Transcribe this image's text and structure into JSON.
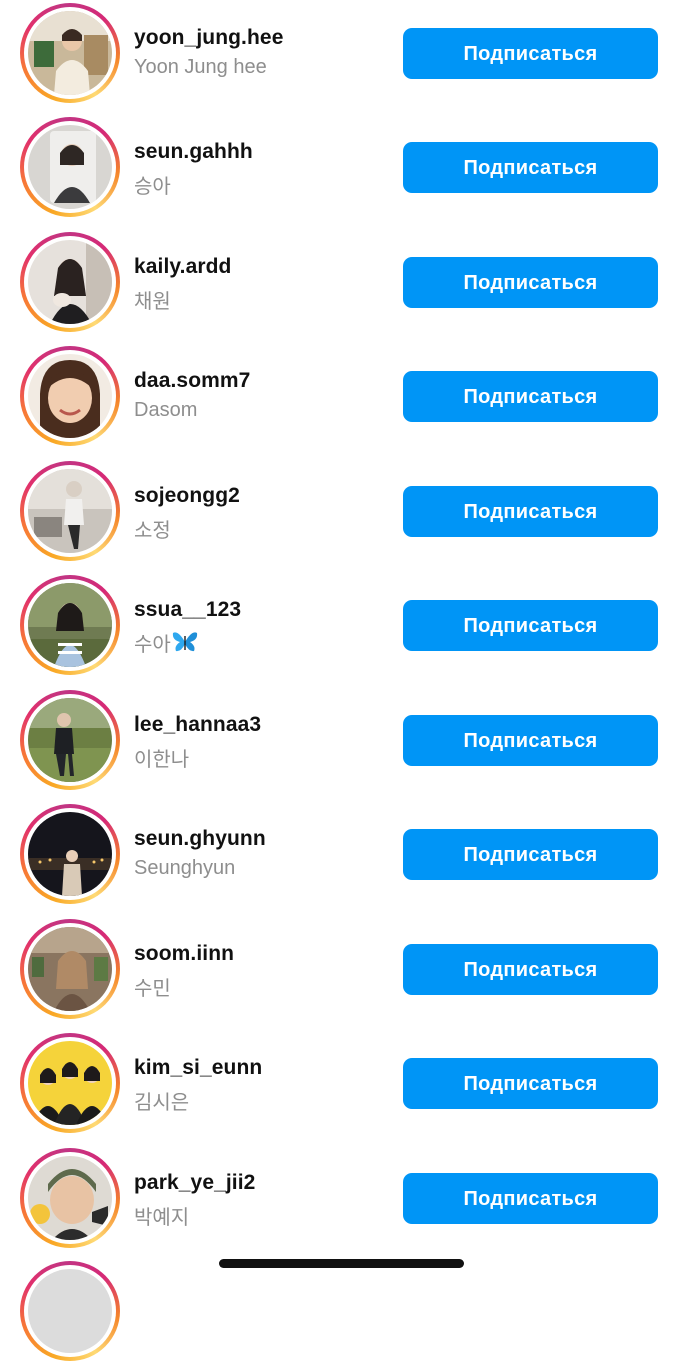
{
  "follow_label": "Подписаться",
  "suggestions": [
    {
      "username": "yoon_jung.hee",
      "full_name": "Yoon Jung hee",
      "avatar_icon": "avatar-photo"
    },
    {
      "username": "seun.gahhh",
      "full_name": "승아",
      "avatar_icon": "avatar-photo"
    },
    {
      "username": "kaily.ardd",
      "full_name": "채원",
      "avatar_icon": "avatar-photo"
    },
    {
      "username": "daa.somm7",
      "full_name": "Dasom",
      "avatar_icon": "avatar-photo"
    },
    {
      "username": "sojeongg2",
      "full_name": "소정",
      "avatar_icon": "avatar-photo"
    },
    {
      "username": "ssua__123",
      "full_name": "수아",
      "name_emoji": "butterfly-icon",
      "avatar_icon": "avatar-photo"
    },
    {
      "username": "lee_hannaa3",
      "full_name": "이한나",
      "avatar_icon": "avatar-photo"
    },
    {
      "username": "seun.ghyunn",
      "full_name": "Seunghyun",
      "avatar_icon": "avatar-photo"
    },
    {
      "username": "soom.iinn",
      "full_name": "수민",
      "avatar_icon": "avatar-photo"
    },
    {
      "username": "kim_si_eunn",
      "full_name": "김시은",
      "avatar_icon": "avatar-photo"
    },
    {
      "username": "park_ye_jii2",
      "full_name": "박예지",
      "avatar_icon": "avatar-photo"
    }
  ],
  "colors": {
    "follow_button": "#0095f6",
    "username_text": "#111111",
    "full_name_text": "#8e8e8e",
    "story_ring": [
      "#f9a825",
      "#e1306c",
      "#c13584"
    ]
  }
}
